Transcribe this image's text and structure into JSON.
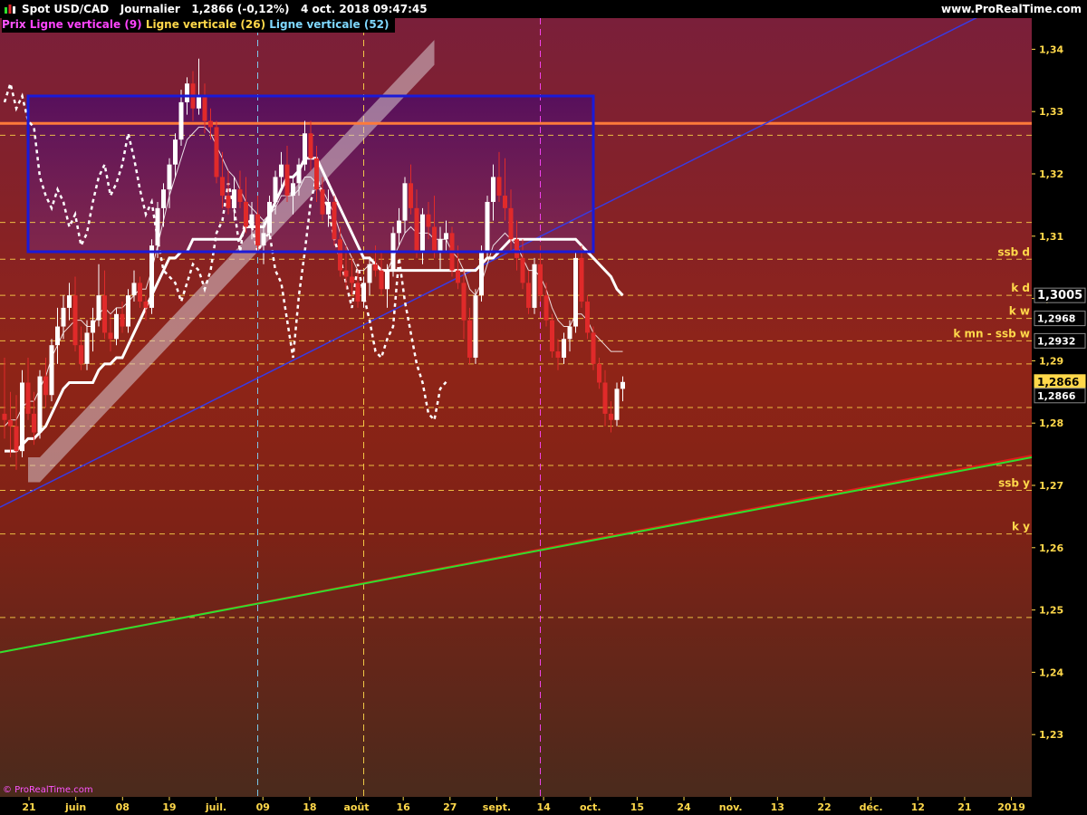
{
  "header": {
    "instrument": "Spot USD/CAD",
    "period": "Journalier",
    "quote": "1,2866 (-0,12%)",
    "datetime": "4 oct. 2018 09:47:45",
    "site": "www.ProRealTime.com"
  },
  "legend": [
    {
      "label": "Prix",
      "color": "#ff55ff"
    },
    {
      "label": "Ligne verticale (9)",
      "color": "#ff44ff"
    },
    {
      "label": "Ligne verticale (26)",
      "color": "#ffd84a"
    },
    {
      "label": "Ligne verticale (52)",
      "color": "#7fd8ff"
    }
  ],
  "watermark": "© ProRealTime.com",
  "colors": {
    "bg_top": "#7a1f3a",
    "bg_mid": "#8f2417",
    "bg_bottom": "#4a2a1c",
    "axis_bg": "#000000",
    "level_line": "#ffd84a",
    "up_candle": "#ffffff",
    "down_candle": "#e02a2a",
    "box": "#1a1ad8",
    "orange_line": "#ff7a3a",
    "blue_line": "#3a3ae0",
    "green_line": "#2ee02e",
    "red_line": "#e01a1a",
    "cloud": "#d8c8d0",
    "vline_9": "#ff44ff",
    "vline_26": "#ffd84a",
    "vline_52": "#7fd8ff"
  },
  "chart_data": {
    "type": "candlestick",
    "instrument": "Spot USD/CAD",
    "timeframe": "Journalier",
    "ylim": [
      1.22,
      1.345
    ],
    "y_ticks": [
      "1,23",
      "1,24",
      "1,25",
      "1,26",
      "1,27",
      "1,28",
      "1,29",
      "1,3",
      "1,31",
      "1,32",
      "1,33",
      "1,34"
    ],
    "x_ticks": [
      "21",
      "juin",
      "08",
      "19",
      "juil.",
      "09",
      "18",
      "août",
      "16",
      "27",
      "sept.",
      "14",
      "oct.",
      "15",
      "24",
      "nov.",
      "13",
      "22",
      "déc.",
      "12",
      "21",
      "2019"
    ],
    "price_labels": [
      {
        "value": 1.3005,
        "text": "1,3005",
        "style": "main"
      },
      {
        "value": 1.2968,
        "text": "1,2968",
        "style": "small"
      },
      {
        "value": 1.2932,
        "text": "1,2932",
        "style": "small"
      },
      {
        "value": 1.2866,
        "text": "1,2866",
        "style": "highlight"
      },
      {
        "value": 1.2866,
        "text": "1,2866",
        "style": "dark"
      }
    ],
    "levels": [
      {
        "value": 1.3262,
        "label": ""
      },
      {
        "value": 1.3122,
        "label": ""
      },
      {
        "value": 1.3063,
        "label": "ssb d"
      },
      {
        "value": 1.3005,
        "label": "k d"
      },
      {
        "value": 1.2968,
        "label": "k w"
      },
      {
        "value": 1.2932,
        "label": "k mn - ssb w"
      },
      {
        "value": 1.2895,
        "label": ""
      },
      {
        "value": 1.2825,
        "label": ""
      },
      {
        "value": 1.2795,
        "label": ""
      },
      {
        "value": 1.2732,
        "label": ""
      },
      {
        "value": 1.2692,
        "label": "ssb y"
      },
      {
        "value": 1.2622,
        "label": "k y"
      },
      {
        "value": 1.2488,
        "label": ""
      }
    ],
    "horizontal_line": 1.3281,
    "candles": [
      [
        1.2815,
        1.2905,
        1.2775,
        1.2805
      ],
      [
        1.2805,
        1.285,
        1.2745,
        1.2795
      ],
      [
        1.2795,
        1.2845,
        1.2725,
        1.2755
      ],
      [
        1.2755,
        1.2885,
        1.2745,
        1.2865
      ],
      [
        1.2865,
        1.2905,
        1.2805,
        1.2815
      ],
      [
        1.2815,
        1.285,
        1.2765,
        1.2785
      ],
      [
        1.2785,
        1.2885,
        1.2775,
        1.2875
      ],
      [
        1.2875,
        1.2905,
        1.2825,
        1.2845
      ],
      [
        1.2845,
        1.2935,
        1.2835,
        1.2925
      ],
      [
        1.2925,
        1.2985,
        1.2895,
        1.2955
      ],
      [
        1.2955,
        1.3005,
        1.2935,
        1.2985
      ],
      [
        1.2985,
        1.3025,
        1.2965,
        1.3005
      ],
      [
        1.3005,
        1.3035,
        1.2915,
        1.2925
      ],
      [
        1.2925,
        1.2955,
        1.2885,
        1.2895
      ],
      [
        1.2895,
        1.2965,
        1.2885,
        1.2945
      ],
      [
        1.2945,
        1.2985,
        1.2915,
        1.2965
      ],
      [
        1.2965,
        1.3055,
        1.2955,
        1.3005
      ],
      [
        1.3005,
        1.3045,
        1.2935,
        1.2945
      ],
      [
        1.2945,
        1.2975,
        1.2915,
        1.2935
      ],
      [
        1.2935,
        1.2985,
        1.2925,
        1.2975
      ],
      [
        1.2975,
        1.2995,
        1.2945,
        1.2955
      ],
      [
        1.2955,
        1.3015,
        1.2945,
        1.3005
      ],
      [
        1.3005,
        1.3045,
        1.2995,
        1.3025
      ],
      [
        1.3025,
        1.3035,
        1.2985,
        1.2995
      ],
      [
        1.2995,
        1.3005,
        1.2965,
        1.2985
      ],
      [
        1.2985,
        1.3095,
        1.2975,
        1.3085
      ],
      [
        1.3085,
        1.3155,
        1.3065,
        1.3145
      ],
      [
        1.3145,
        1.3185,
        1.3115,
        1.3175
      ],
      [
        1.3175,
        1.3225,
        1.3145,
        1.3215
      ],
      [
        1.3215,
        1.3265,
        1.3195,
        1.3255
      ],
      [
        1.3255,
        1.3335,
        1.3245,
        1.3315
      ],
      [
        1.3315,
        1.3355,
        1.3295,
        1.3345
      ],
      [
        1.3345,
        1.3365,
        1.3285,
        1.3305
      ],
      [
        1.3305,
        1.3385,
        1.3295,
        1.3325
      ],
      [
        1.3325,
        1.3345,
        1.3265,
        1.3285
      ],
      [
        1.3285,
        1.3305,
        1.3255,
        1.3275
      ],
      [
        1.3275,
        1.3285,
        1.3185,
        1.3195
      ],
      [
        1.3195,
        1.3235,
        1.3145,
        1.3165
      ],
      [
        1.3165,
        1.3205,
        1.3135,
        1.3145
      ],
      [
        1.3145,
        1.3195,
        1.3125,
        1.3175
      ],
      [
        1.3175,
        1.3205,
        1.3145,
        1.3155
      ],
      [
        1.3155,
        1.3195,
        1.3105,
        1.3115
      ],
      [
        1.3115,
        1.3155,
        1.3095,
        1.3135
      ],
      [
        1.3135,
        1.3165,
        1.3075,
        1.3085
      ],
      [
        1.3085,
        1.3125,
        1.3055,
        1.3105
      ],
      [
        1.3105,
        1.3165,
        1.3095,
        1.3155
      ],
      [
        1.3155,
        1.3205,
        1.3135,
        1.3195
      ],
      [
        1.3195,
        1.3235,
        1.3175,
        1.3215
      ],
      [
        1.3215,
        1.3245,
        1.3155,
        1.3165
      ],
      [
        1.3165,
        1.3195,
        1.3135,
        1.3185
      ],
      [
        1.3185,
        1.3225,
        1.3165,
        1.3215
      ],
      [
        1.3215,
        1.3285,
        1.3205,
        1.3265
      ],
      [
        1.3265,
        1.3285,
        1.3205,
        1.3225
      ],
      [
        1.3225,
        1.3245,
        1.3155,
        1.3175
      ],
      [
        1.3175,
        1.3195,
        1.3125,
        1.3135
      ],
      [
        1.3135,
        1.3175,
        1.3115,
        1.3155
      ],
      [
        1.3155,
        1.3165,
        1.3085,
        1.3095
      ],
      [
        1.3095,
        1.3115,
        1.3035,
        1.3045
      ],
      [
        1.3045,
        1.3085,
        1.3015,
        1.3035
      ],
      [
        1.3035,
        1.3065,
        1.3005,
        1.3025
      ],
      [
        1.3025,
        1.3045,
        1.2985,
        1.2995
      ],
      [
        1.2995,
        1.3035,
        1.2985,
        1.3025
      ],
      [
        1.3025,
        1.3065,
        1.3005,
        1.3055
      ],
      [
        1.3055,
        1.3085,
        1.3035,
        1.3045
      ],
      [
        1.3045,
        1.3075,
        1.3005,
        1.3015
      ],
      [
        1.3015,
        1.3055,
        1.2985,
        1.3045
      ],
      [
        1.3045,
        1.3115,
        1.3035,
        1.3105
      ],
      [
        1.3105,
        1.3145,
        1.3085,
        1.3125
      ],
      [
        1.3125,
        1.3195,
        1.3105,
        1.3185
      ],
      [
        1.3185,
        1.3215,
        1.3135,
        1.3145
      ],
      [
        1.3145,
        1.3175,
        1.3065,
        1.3075
      ],
      [
        1.3075,
        1.3145,
        1.3055,
        1.3135
      ],
      [
        1.3135,
        1.3155,
        1.3095,
        1.3115
      ],
      [
        1.3115,
        1.3165,
        1.3065,
        1.3075
      ],
      [
        1.3075,
        1.3115,
        1.3045,
        1.3095
      ],
      [
        1.3095,
        1.3125,
        1.3075,
        1.3105
      ],
      [
        1.3105,
        1.3115,
        1.3035,
        1.3045
      ],
      [
        1.3045,
        1.3085,
        1.3015,
        1.3025
      ],
      [
        1.3025,
        1.3045,
        1.2935,
        1.2965
      ],
      [
        1.2965,
        1.2985,
        1.2895,
        1.2905
      ],
      [
        1.2905,
        1.3015,
        1.2895,
        1.3005
      ],
      [
        1.3005,
        1.3085,
        1.2995,
        1.3075
      ],
      [
        1.3075,
        1.3165,
        1.3065,
        1.3155
      ],
      [
        1.3155,
        1.3215,
        1.3125,
        1.3195
      ],
      [
        1.3195,
        1.3235,
        1.3155,
        1.3165
      ],
      [
        1.3165,
        1.3225,
        1.3125,
        1.3145
      ],
      [
        1.3145,
        1.3175,
        1.3075,
        1.3095
      ],
      [
        1.3095,
        1.3125,
        1.3045,
        1.3065
      ],
      [
        1.3065,
        1.3095,
        1.3015,
        1.3025
      ],
      [
        1.3025,
        1.3045,
        1.2975,
        1.2985
      ],
      [
        1.2985,
        1.3065,
        1.2975,
        1.3055
      ],
      [
        1.3055,
        1.3085,
        1.2995,
        1.3005
      ],
      [
        1.3005,
        1.3025,
        1.2955,
        1.2965
      ],
      [
        1.2965,
        1.2975,
        1.2905,
        1.2915
      ],
      [
        1.2915,
        1.2935,
        1.2885,
        1.2905
      ],
      [
        1.2905,
        1.2945,
        1.2895,
        1.2935
      ],
      [
        1.2935,
        1.2965,
        1.2915,
        1.2955
      ],
      [
        1.2955,
        1.3075,
        1.2945,
        1.3065
      ],
      [
        1.3065,
        1.3085,
        1.2985,
        1.2995
      ],
      [
        1.2995,
        1.3005,
        1.2935,
        1.2945
      ],
      [
        1.2945,
        1.2955,
        1.2885,
        1.2895
      ],
      [
        1.2895,
        1.2905,
        1.2855,
        1.2865
      ],
      [
        1.2865,
        1.2885,
        1.2795,
        1.2815
      ],
      [
        1.2815,
        1.2835,
        1.2785,
        1.2805
      ],
      [
        1.2805,
        1.2865,
        1.2795,
        1.2855
      ],
      [
        1.2855,
        1.2875,
        1.2835,
        1.2866
      ]
    ],
    "tenkan": [
      1.2795,
      1.2805,
      1.2805,
      1.2825,
      1.2835,
      1.2835,
      1.2855,
      1.2875,
      1.2905,
      1.2925,
      1.2945,
      1.2955,
      1.2965,
      1.2965,
      1.2955,
      1.2955,
      1.2975,
      1.2985,
      1.2975,
      1.2985,
      1.2985,
      1.2995,
      1.3005,
      1.3015,
      1.3015,
      1.3045,
      1.3085,
      1.3125,
      1.3165,
      1.3195,
      1.3225,
      1.3255,
      1.3265,
      1.3275,
      1.3275,
      1.3265,
      1.3245,
      1.3225,
      1.3205,
      1.3195,
      1.3175,
      1.3155,
      1.3145,
      1.3135,
      1.3125,
      1.3135,
      1.3145,
      1.3165,
      1.3165,
      1.3165,
      1.3175,
      1.3195,
      1.3195,
      1.3185,
      1.3175,
      1.3155,
      1.3135,
      1.3105,
      1.3085,
      1.3065,
      1.3045,
      1.3045,
      1.3055,
      1.3055,
      1.3045,
      1.3045,
      1.3065,
      1.3085,
      1.3105,
      1.3115,
      1.3105,
      1.3105,
      1.3105,
      1.3095,
      1.3095,
      1.3095,
      1.3075,
      1.3065,
      1.3045,
      1.3015,
      1.3005,
      1.3025,
      1.3055,
      1.3085,
      1.3095,
      1.3105,
      1.3095,
      1.3085,
      1.3065,
      1.3045,
      1.3045,
      1.3035,
      1.3015,
      1.2985,
      1.2965,
      1.2955,
      1.2955,
      1.2975,
      1.2975,
      1.2965,
      1.2945,
      1.2935,
      1.2925,
      1.2915,
      1.2915,
      1.2915
    ],
    "kijun": [
      1.2755,
      1.2755,
      1.2755,
      1.2765,
      1.2775,
      1.2775,
      1.2785,
      1.2795,
      1.2815,
      1.2835,
      1.2855,
      1.2865,
      1.2865,
      1.2865,
      1.2865,
      1.2865,
      1.2885,
      1.2895,
      1.2895,
      1.2905,
      1.2905,
      1.2925,
      1.2945,
      1.2965,
      1.2985,
      1.3005,
      1.3025,
      1.3045,
      1.3065,
      1.3065,
      1.3075,
      1.3075,
      1.3095,
      1.3095,
      1.3095,
      1.3095,
      1.3095,
      1.3095,
      1.3095,
      1.3095,
      1.3095,
      1.3115,
      1.3115,
      1.3115,
      1.3115,
      1.3135,
      1.3155,
      1.3175,
      1.3195,
      1.3195,
      1.3205,
      1.3225,
      1.3225,
      1.3225,
      1.3205,
      1.3185,
      1.3165,
      1.3145,
      1.3125,
      1.3105,
      1.3085,
      1.3065,
      1.3065,
      1.3055,
      1.3045,
      1.3045,
      1.3045,
      1.3045,
      1.3045,
      1.3045,
      1.3045,
      1.3045,
      1.3045,
      1.3045,
      1.3045,
      1.3045,
      1.3045,
      1.3045,
      1.3045,
      1.3045,
      1.3045,
      1.3055,
      1.3065,
      1.3065,
      1.3075,
      1.3085,
      1.3095,
      1.3095,
      1.3095,
      1.3095,
      1.3095,
      1.3095,
      1.3095,
      1.3095,
      1.3095,
      1.3095,
      1.3095,
      1.3095,
      1.3085,
      1.3075,
      1.3065,
      1.3055,
      1.3045,
      1.3035,
      1.3015,
      1.3005
    ],
    "chikou": [
      1.3315,
      1.3345,
      1.3305,
      1.3325,
      1.3285,
      1.3275,
      1.3195,
      1.3165,
      1.3145,
      1.3175,
      1.3155,
      1.3115,
      1.3135,
      1.3085,
      1.3105,
      1.3155,
      1.3195,
      1.3215,
      1.3165,
      1.3185,
      1.3215,
      1.3265,
      1.3225,
      1.3175,
      1.3135,
      1.3155,
      1.3095,
      1.3045,
      1.3035,
      1.3025,
      1.2995,
      1.3025,
      1.3055,
      1.3045,
      1.3015,
      1.3045,
      1.3105,
      1.3125,
      1.3185,
      1.3145,
      1.3075,
      1.3135,
      1.3115,
      1.3075,
      1.3095,
      1.3105,
      1.3045,
      1.3025,
      1.2965,
      1.2905,
      1.3005,
      1.3075,
      1.3155,
      1.3195,
      1.3165,
      1.3145,
      1.3095,
      1.3065,
      1.3025,
      1.2985,
      1.3055,
      1.3005,
      1.2965,
      1.2915,
      1.2905,
      1.2935,
      1.2955,
      1.3065,
      1.2995,
      1.2945,
      1.2895,
      1.2865,
      1.2815,
      1.2805,
      1.2855,
      1.2866
    ],
    "cloud": [
      [
        1.2705,
        1.2745
      ],
      [
        1.2705,
        1.2745
      ],
      [
        1.2705,
        1.2745
      ],
      [
        1.2715,
        1.2755
      ],
      [
        1.2725,
        1.2765
      ],
      [
        1.2735,
        1.2775
      ],
      [
        1.2745,
        1.2785
      ],
      [
        1.2755,
        1.2795
      ],
      [
        1.2765,
        1.2805
      ],
      [
        1.2775,
        1.2815
      ],
      [
        1.2785,
        1.2825
      ],
      [
        1.2795,
        1.2835
      ],
      [
        1.2805,
        1.2845
      ],
      [
        1.2815,
        1.2855
      ],
      [
        1.2825,
        1.2865
      ],
      [
        1.2835,
        1.2875
      ],
      [
        1.2845,
        1.2885
      ],
      [
        1.2855,
        1.2895
      ],
      [
        1.2865,
        1.2905
      ],
      [
        1.2875,
        1.2915
      ],
      [
        1.2885,
        1.2925
      ],
      [
        1.2895,
        1.2935
      ],
      [
        1.2905,
        1.2945
      ],
      [
        1.2915,
        1.2955
      ],
      [
        1.2925,
        1.2965
      ],
      [
        1.2935,
        1.2975
      ],
      [
        1.2945,
        1.2985
      ],
      [
        1.2955,
        1.2995
      ],
      [
        1.2965,
        1.3005
      ],
      [
        1.2975,
        1.3015
      ],
      [
        1.2985,
        1.3025
      ],
      [
        1.2995,
        1.3035
      ],
      [
        1.3005,
        1.3045
      ],
      [
        1.3015,
        1.3055
      ],
      [
        1.3025,
        1.3065
      ],
      [
        1.3035,
        1.3075
      ],
      [
        1.3045,
        1.3085
      ],
      [
        1.3055,
        1.3095
      ],
      [
        1.3065,
        1.3105
      ],
      [
        1.3075,
        1.3115
      ],
      [
        1.3085,
        1.3125
      ],
      [
        1.3095,
        1.3135
      ],
      [
        1.3105,
        1.3145
      ],
      [
        1.3115,
        1.3155
      ],
      [
        1.3125,
        1.3165
      ],
      [
        1.3135,
        1.3175
      ],
      [
        1.3145,
        1.3185
      ],
      [
        1.3155,
        1.3195
      ],
      [
        1.3165,
        1.3205
      ],
      [
        1.3175,
        1.3215
      ],
      [
        1.3185,
        1.3225
      ],
      [
        1.3195,
        1.3235
      ],
      [
        1.3205,
        1.3245
      ],
      [
        1.3215,
        1.3255
      ],
      [
        1.3225,
        1.3265
      ],
      [
        1.3235,
        1.3275
      ],
      [
        1.3245,
        1.3285
      ],
      [
        1.3255,
        1.3295
      ],
      [
        1.3265,
        1.3305
      ],
      [
        1.3275,
        1.3315
      ],
      [
        1.3285,
        1.3325
      ],
      [
        1.3295,
        1.3335
      ],
      [
        1.3305,
        1.3345
      ],
      [
        1.3315,
        1.3355
      ],
      [
        1.3325,
        1.3365
      ],
      [
        1.3335,
        1.3375
      ],
      [
        1.3345,
        1.3385
      ],
      [
        1.3355,
        1.3395
      ],
      [
        1.3365,
        1.3405
      ],
      [
        1.3375,
        1.3415
      ]
    ],
    "vertical_lines": [
      {
        "period": "52",
        "x_index": 43,
        "color": "#7fd8ff"
      },
      {
        "period": "26",
        "x_index": 61,
        "color": "#ffd84a"
      },
      {
        "period": "9",
        "x_index": 91,
        "color": "#ff44ff"
      }
    ],
    "box": {
      "y_top": 1.3325,
      "y_bottom": 1.3075,
      "x_start_index": 4,
      "x_end_index": 100
    },
    "trendlines": [
      {
        "name": "",
        "color": "#3a3ae0",
        "y_start": 1.2665,
        "y_end": 1.3495
      },
      {
        "name": "",
        "color": "#e01a1a",
        "y_start": 1.2432,
        "y_end": 1.2748
      },
      {
        "name": "",
        "color": "#2ee02e",
        "y_start": 1.2432,
        "y_end": 1.2745
      }
    ]
  }
}
